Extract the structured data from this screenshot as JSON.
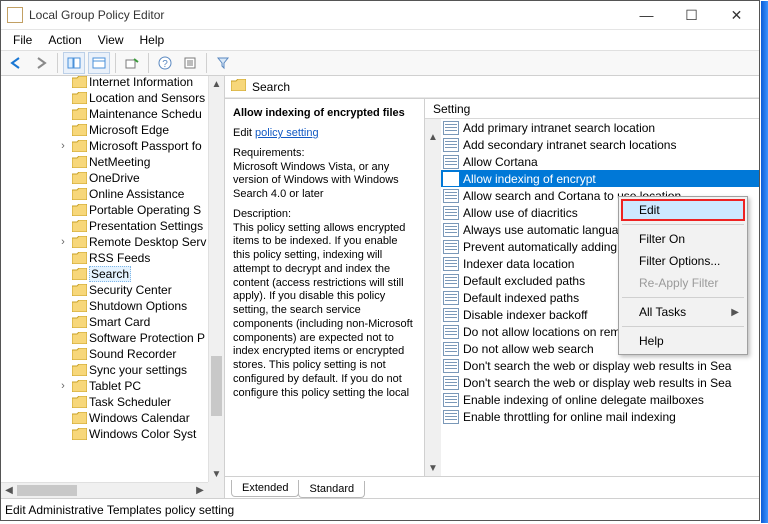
{
  "titlebar": {
    "title": "Local Group Policy Editor"
  },
  "menubar": [
    "File",
    "Action",
    "View",
    "Help"
  ],
  "tree": [
    {
      "d": 4,
      "t": "",
      "l": "Internet Information"
    },
    {
      "d": 4,
      "t": "",
      "l": "Location and Sensors"
    },
    {
      "d": 4,
      "t": "",
      "l": "Maintenance Schedu"
    },
    {
      "d": 4,
      "t": "",
      "l": "Microsoft Edge"
    },
    {
      "d": 4,
      "t": ">",
      "l": "Microsoft Passport fo"
    },
    {
      "d": 4,
      "t": "",
      "l": "NetMeeting"
    },
    {
      "d": 4,
      "t": "",
      "l": "OneDrive"
    },
    {
      "d": 4,
      "t": "",
      "l": "Online Assistance"
    },
    {
      "d": 4,
      "t": "",
      "l": "Portable Operating S"
    },
    {
      "d": 4,
      "t": "",
      "l": "Presentation Settings"
    },
    {
      "d": 4,
      "t": ">",
      "l": "Remote Desktop Serv"
    },
    {
      "d": 4,
      "t": "",
      "l": "RSS Feeds"
    },
    {
      "d": 4,
      "t": "",
      "l": "Search",
      "sel": true
    },
    {
      "d": 4,
      "t": "",
      "l": "Security Center"
    },
    {
      "d": 4,
      "t": "",
      "l": "Shutdown Options"
    },
    {
      "d": 4,
      "t": "",
      "l": "Smart Card"
    },
    {
      "d": 4,
      "t": "",
      "l": "Software Protection P"
    },
    {
      "d": 4,
      "t": "",
      "l": "Sound Recorder"
    },
    {
      "d": 4,
      "t": "",
      "l": "Sync your settings"
    },
    {
      "d": 4,
      "t": ">",
      "l": "Tablet PC"
    },
    {
      "d": 4,
      "t": "",
      "l": "Task Scheduler"
    },
    {
      "d": 4,
      "t": "",
      "l": "Windows Calendar"
    },
    {
      "d": 4,
      "t": "",
      "l": "Windows Color Syst"
    }
  ],
  "main": {
    "header": "Search",
    "selected_title": "Allow indexing of encrypted files",
    "edit_prefix": "Edit ",
    "edit_link": "policy setting",
    "req_label": "Requirements:",
    "req_text": "Microsoft Windows Vista, or any version of Windows with Windows Search 4.0 or later",
    "desc_label": "Description:",
    "desc_text": "This policy setting allows encrypted items to be indexed. If you enable this policy setting, indexing  will attempt to decrypt and index the content (access restrictions will still apply). If you disable this policy setting, the search service components (including non-Microsoft components) are expected not to index encrypted items or encrypted stores. This policy setting is not configured by default. If you do not configure this policy setting the local"
  },
  "list": {
    "column": "Setting",
    "items": [
      "Add primary intranet search location",
      "Add secondary intranet search locations",
      "Allow Cortana",
      "Allow indexing of encrypted files",
      "Allow search and Cortana to use location",
      "Allow use of diacritics",
      "Always use automatic language detection",
      "Prevent automatically adding shared folders",
      "Indexer data location",
      "Default excluded paths",
      "Default indexed paths",
      "Disable indexer backoff",
      "Do not allow locations on removable drives to be",
      "Do not allow web search",
      "Don't search the web or display web results in Sea",
      "Don't search the web or display web results in Sea",
      "Enable indexing of online delegate mailboxes",
      "Enable throttling for online mail indexing"
    ],
    "selected_index": 3
  },
  "tabs": {
    "extended": "Extended",
    "standard": "Standard"
  },
  "statusbar": "Edit Administrative Templates policy setting",
  "context_menu": {
    "items": [
      {
        "l": "Edit",
        "hov": true
      },
      {
        "sep": true
      },
      {
        "l": "Filter On"
      },
      {
        "l": "Filter Options..."
      },
      {
        "l": "Re-Apply Filter",
        "disabled": true
      },
      {
        "sep": true
      },
      {
        "l": "All Tasks",
        "sub": true
      },
      {
        "sep": true
      },
      {
        "l": "Help"
      }
    ]
  }
}
